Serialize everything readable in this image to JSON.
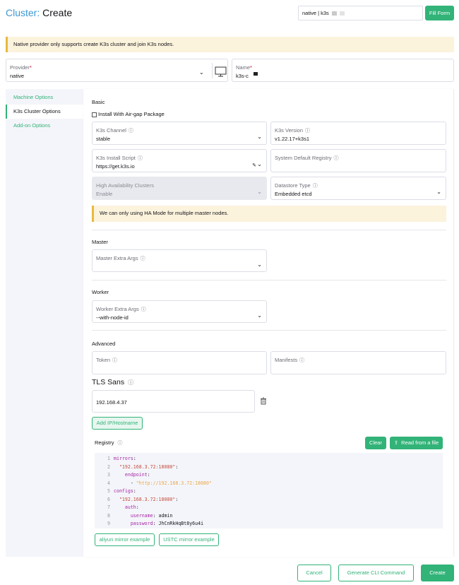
{
  "header": {
    "breadcrumb": "Cluster:",
    "title": "Create",
    "search_value": "native | k3s",
    "fill_form_label": "Fill Form"
  },
  "banner": {
    "text": "Native provider only supports create K3s cluster and join K3s nodes."
  },
  "provider": {
    "label": "Provider",
    "required_mark": "*",
    "value": "native"
  },
  "name": {
    "label": "Name",
    "required_mark": "*",
    "value": "k3s-c"
  },
  "sidenav": {
    "items": [
      {
        "label": "Machine Options"
      },
      {
        "label": "K3s Cluster Options"
      },
      {
        "label": "Add-on Options"
      }
    ]
  },
  "basic": {
    "heading": "Basic",
    "airgap_label": "Install With Air-gap Package",
    "channel": {
      "label": "K3s Channel",
      "value": "stable"
    },
    "version": {
      "label": "K3s Version",
      "value": "v1.22.17+k3s1"
    },
    "install_script": {
      "label": "K3s Install Script",
      "value": "https://get.k3s.io"
    },
    "registry_default": {
      "label": "System Default Registry",
      "value": ""
    },
    "ha": {
      "label": "High Availability Clusters",
      "value": "Enable"
    },
    "datastore": {
      "label": "Datastore Type",
      "value": "Embedded etcd"
    },
    "ha_warning": "We can only using HA Mode for multiple master nodes."
  },
  "master": {
    "heading": "Master",
    "extra_args": {
      "label": "Master Extra Args",
      "value": ""
    }
  },
  "worker": {
    "heading": "Worker",
    "extra_args": {
      "label": "Worker Extra Args",
      "value": "--with-node-id"
    }
  },
  "advanced": {
    "heading": "Advanced",
    "token": {
      "label": "Token",
      "value": ""
    },
    "manifests": {
      "label": "Manifests",
      "value": ""
    },
    "tls_heading": "TLS Sans",
    "tls_value": "192.168.4.37",
    "add_ip_label": "Add IP/Hostname"
  },
  "registry": {
    "label": "Registry",
    "clear_label": "Clear",
    "read_file_label": "Read from a file",
    "lines": [
      {
        "n": "1",
        "indent": "",
        "key": "mirrors",
        "punct": ":",
        "val": ""
      },
      {
        "n": "2",
        "indent": "  ",
        "key": "\"192.168.3.72:18080\"",
        "punct": ":",
        "val": ""
      },
      {
        "n": "3",
        "indent": "    ",
        "key": "endpoint",
        "punct": ":",
        "val": ""
      },
      {
        "n": "4",
        "indent": "      ",
        "key": "- ",
        "punct": "",
        "val": "\"http://192.168.3.72:18080\""
      },
      {
        "n": "5",
        "indent": "",
        "key": "configs",
        "punct": ":",
        "val": ""
      },
      {
        "n": "6",
        "indent": "  ",
        "key": "\"192.168.3.72:18080\"",
        "punct": ":",
        "val": ""
      },
      {
        "n": "7",
        "indent": "    ",
        "key": "auth",
        "punct": ":",
        "val": ""
      },
      {
        "n": "8",
        "indent": "      ",
        "key": "username",
        "punct": ": ",
        "val": "admin"
      },
      {
        "n": "9",
        "indent": "      ",
        "key": "password",
        "punct": ": ",
        "val": "JhCnRkHqBt8y6u4i"
      }
    ],
    "aliyun_label": "aliyun mirror example",
    "ustc_label": "USTC mirror example"
  },
  "footer": {
    "cancel_label": "Cancel",
    "cli_label": "Generate CLI Command",
    "create_label": "Create"
  },
  "colors": {
    "accent": "#32b378",
    "link": "#3d98d3",
    "warning_bg": "#fcf3dd",
    "warning_border": "#e8b93e"
  }
}
